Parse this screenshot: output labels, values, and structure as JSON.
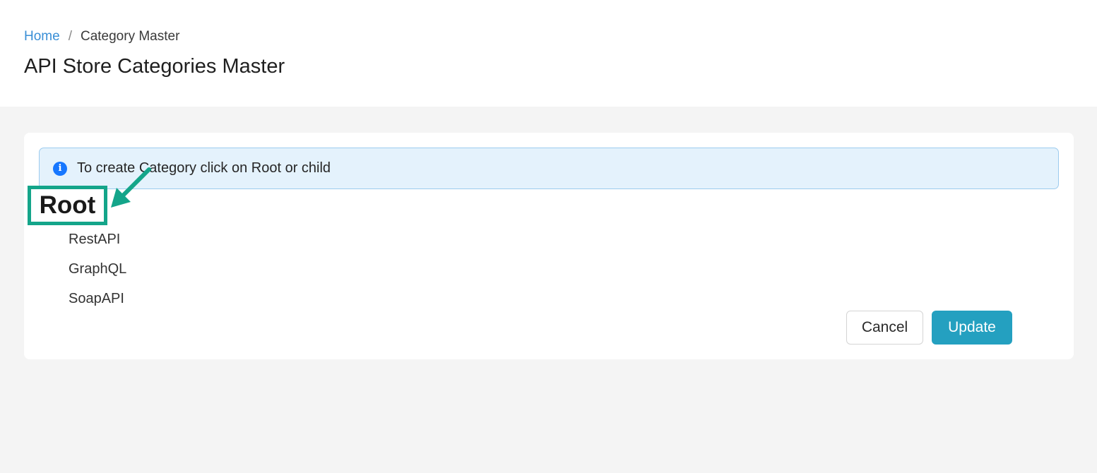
{
  "breadcrumb": {
    "home": "Home",
    "separator": "/",
    "current": "Category Master"
  },
  "page": {
    "title": "API Store Categories Master"
  },
  "alert": {
    "icon": "info-icon",
    "icon_glyph": "i",
    "text": "To create Category click on Root or child"
  },
  "tree": {
    "root_label": "Root",
    "children": [
      "RestAPI",
      "GraphQL",
      "SoapAPI"
    ]
  },
  "actions": {
    "cancel_label": "Cancel",
    "update_label": "Update"
  },
  "colors": {
    "highlight": "#14a58a",
    "primary_button": "#24a0c0",
    "info_icon": "#1677ff",
    "link": "#3a8fd6"
  }
}
